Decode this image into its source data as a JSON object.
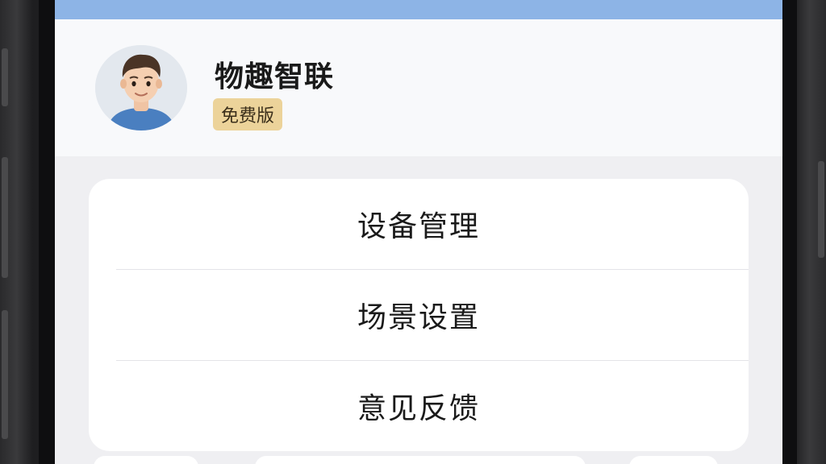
{
  "profile": {
    "app_name": "物趣智联",
    "plan_badge": "免费版",
    "avatar_icon": "user-avatar-icon"
  },
  "menu": {
    "items": [
      {
        "label": "设备管理"
      },
      {
        "label": "场景设置"
      },
      {
        "label": "意见反馈"
      }
    ]
  },
  "colors": {
    "header_accent": "#8db4e6",
    "badge_bg": "#ecd39a",
    "screen_bg": "#efeff2"
  }
}
